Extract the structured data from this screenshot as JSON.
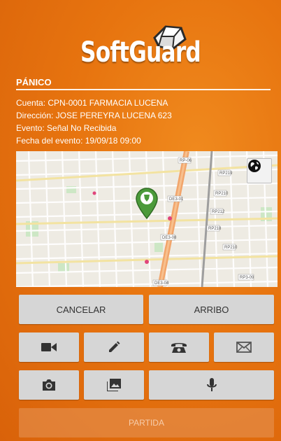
{
  "app": {
    "logo_text": "SoftGuard"
  },
  "event": {
    "title": "PÁNICO",
    "account": "Cuenta: CPN-0001 FARMACIA LUCENA",
    "address": "Dirección: JOSE PEREYRA LUCENA 623",
    "status": "Evento: Señal No Recibida",
    "date": "Fecha del evento: 19/09/18 09:00"
  },
  "map": {
    "road_labels": [
      "RP-06",
      "RP219",
      "RP210",
      "DE3-01",
      "RP212",
      "RP218",
      "RP210",
      "DE3-08",
      "DE3-04",
      "RP3-09"
    ],
    "icons": [
      "globe-icon",
      "map-marker-icon"
    ]
  },
  "actions": {
    "cancel_label": "CANCELAR",
    "arrival_label": "ARRIBO",
    "departure_label": "PARTIDA",
    "icons": [
      "video-camera-icon",
      "pencil-icon",
      "phone-icon",
      "mail-icon",
      "camera-icon",
      "image-icon",
      "microphone-icon"
    ]
  },
  "colors": {
    "background": "#e7740f",
    "button": "#d6d6d6",
    "marker": "#4b9a3a",
    "main_road": "#f2a56b"
  }
}
